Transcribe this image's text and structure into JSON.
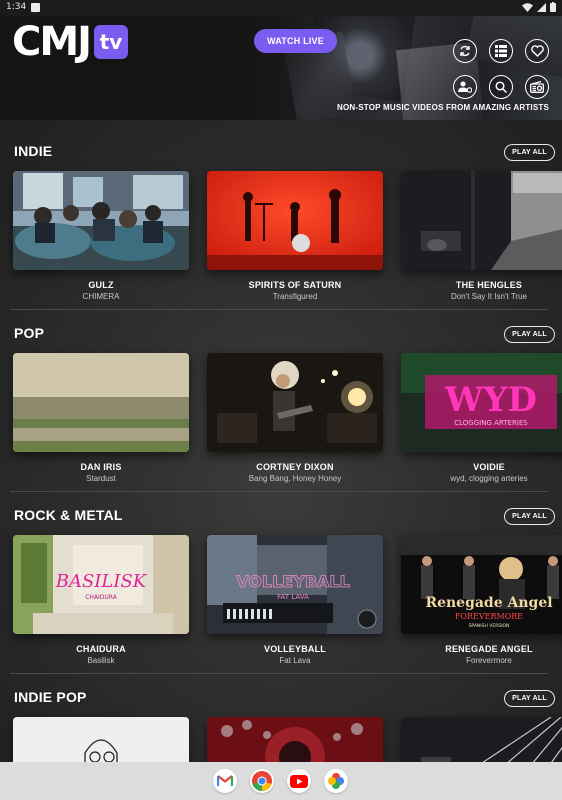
{
  "status": {
    "time": "1:34"
  },
  "header": {
    "logo_text": "CMJ",
    "logo_badge": "tv",
    "watch_live": "WATCH LIVE",
    "tagline": "NON-STOP MUSIC VIDEOS FROM AMAZING ARTISTS",
    "icons": [
      "refresh-icon",
      "list-grid-icon",
      "heart-icon",
      "account-settings-icon",
      "search-icon",
      "radio-icon"
    ]
  },
  "sections": [
    {
      "title": "INDIE",
      "play_all": "PLAY ALL",
      "cards": [
        {
          "artist": "GULZ",
          "song": "CHIMERA"
        },
        {
          "artist": "SPIRITS OF SATURN",
          "song": "Transfigured"
        },
        {
          "artist": "THE HENGLES",
          "song": "Don't Say It Isn't True"
        }
      ]
    },
    {
      "title": "POP",
      "play_all": "PLAY ALL",
      "cards": [
        {
          "artist": "DAN IRIS",
          "song": "Stardust"
        },
        {
          "artist": "CORTNEY DIXON",
          "song": "Bang Bang, Honey Honey"
        },
        {
          "artist": "VOIDIE",
          "song": "wyd, clogging arteries"
        }
      ]
    },
    {
      "title": "ROCK & METAL",
      "play_all": "PLAY ALL",
      "cards": [
        {
          "artist": "CHAIDURA",
          "song": "Basilisk"
        },
        {
          "artist": "VOLLEYBALL",
          "song": "Fat Lava"
        },
        {
          "artist": "RENEGADE ANGEL",
          "song": "Forevermore"
        }
      ]
    },
    {
      "title": "INDIE POP",
      "play_all": "PLAY ALL",
      "cards": []
    }
  ],
  "thumb_text": {
    "voidie_logo": "WYD",
    "voidie_sub": "CLOGGING ARTERIES",
    "chaidura_logo": "BASILISK",
    "chaidura_sub": "CHAIDURA",
    "volleyball_logo": "VOLLEYBALL",
    "volleyball_sub": "FAT LAVA",
    "renegade_logo": "Renegade Angel",
    "renegade_sub": "FOREVERMORE",
    "renegade_sub2": "SPANISH VERSION"
  },
  "dock": [
    "gmail-app",
    "chrome-app",
    "youtube-app",
    "photos-app"
  ],
  "colors": {
    "accent": "#7a5cf0",
    "background": "#262626"
  }
}
